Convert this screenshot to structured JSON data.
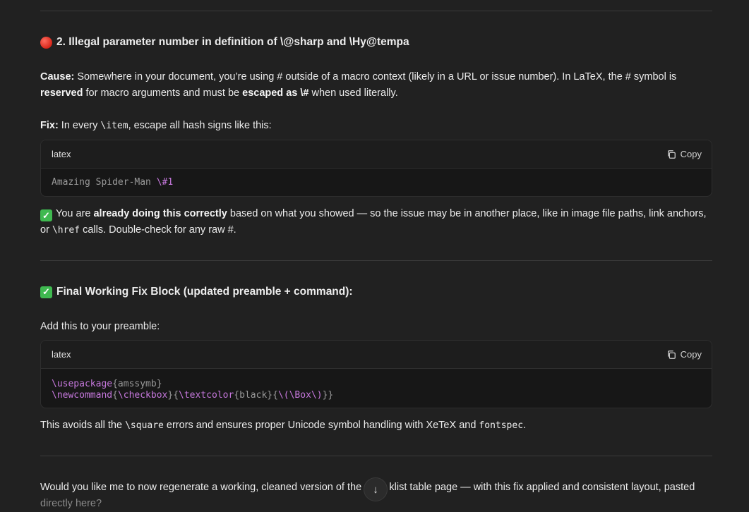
{
  "section2": {
    "heading": "2. Illegal parameter number in definition of \\@sharp and \\Hy@tempa",
    "cause_label": "Cause:",
    "cause_text1": " Somewhere in your document, you’re using # outside of a macro context (likely in a URL or issue number). In LaTeX, the # symbol is ",
    "cause_bold1": "reserved",
    "cause_text2": " for macro arguments and must be ",
    "cause_bold2": "escaped as \\#",
    "cause_text3": " when used literally.",
    "fix_label": "Fix:",
    "fix_text1": " In every ",
    "fix_code": "\\item",
    "fix_text2": ", escape all hash signs like this:",
    "code_lang": "latex",
    "copy_label": "Copy",
    "code_plain": "Amazing Spider-Man ",
    "code_kw": "\\#1",
    "note_text1": "You are ",
    "note_bold": "already doing this correctly",
    "note_text2": " based on what you showed — so the issue may be in another place, like in image file paths, link anchors,",
    "note_text3": "or ",
    "note_code": "\\href",
    "note_text4": " calls. Double-check for any raw #."
  },
  "section3": {
    "heading": "Final Working Fix Block (updated preamble + command):",
    "intro": "Add this to your preamble:",
    "code_lang": "latex",
    "copy_label": "Copy",
    "line1_kw": "\\usepackage",
    "line1_rest": "{amssymb}",
    "line2_kw1": "\\newcommand",
    "line2_b1": "{",
    "line2_kw2": "\\checkbox",
    "line2_b2": "}{",
    "line2_kw3": "\\textcolor",
    "line2_b3": "{black}{",
    "line2_kw4": "\\(\\Box\\)",
    "line2_b4": "}}",
    "after_text1": "This avoids all the ",
    "after_code1": "\\square",
    "after_text2": " errors and ensures proper Unicode symbol handling with XeTeX and ",
    "after_code2": "fontspec",
    "after_text3": "."
  },
  "footer": {
    "question_part1": "Would you like me to now regenerate a working, cleaned version of the c",
    "question_part2": "klist table page — with this fix applied and consistent layout, pasted",
    "question_line2": "directly here?",
    "scroll_icon": "↓"
  },
  "colors": {
    "background": "#212121",
    "code_keyword": "#c678dd",
    "check_green": "#3fb950",
    "red_dot": "#d7261a"
  }
}
